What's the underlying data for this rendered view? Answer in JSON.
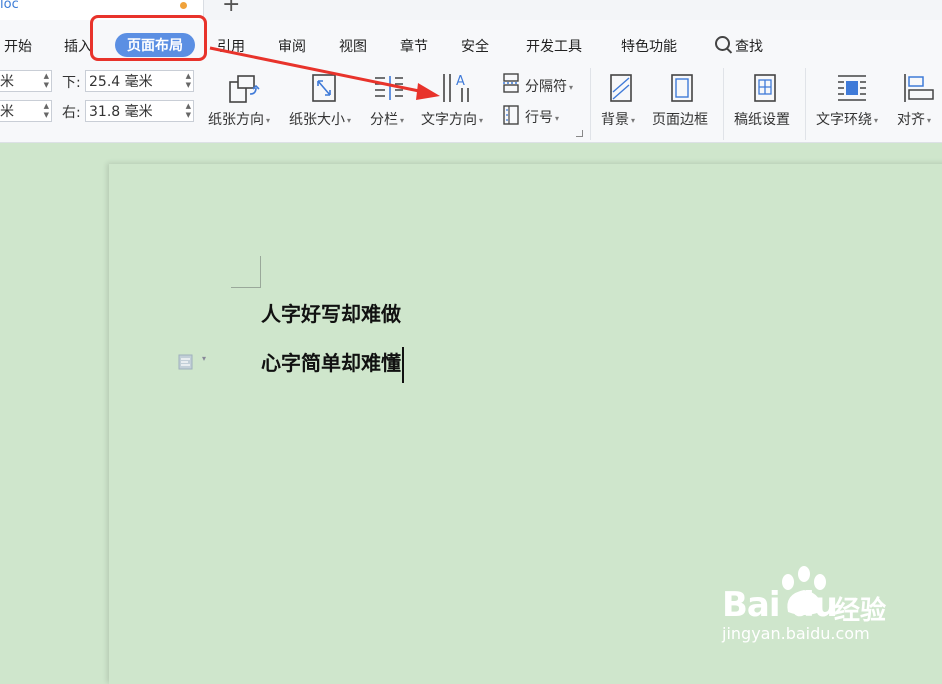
{
  "document_tab": {
    "name": "loc"
  },
  "menu": {
    "items": [
      "开始",
      "插入",
      "页面布局",
      "引用",
      "审阅",
      "视图",
      "章节",
      "安全",
      "开发工具",
      "特色功能"
    ],
    "active": "页面布局",
    "search_label": "查找"
  },
  "margins": {
    "top_left_value": "米",
    "bottom_left_value": "米",
    "bottom_label": "下:",
    "bottom_value": "25.4 毫米",
    "right_label": "右:",
    "right_value": "31.8 毫米"
  },
  "tools": {
    "orientation": "纸张方向",
    "size": "纸张大小",
    "columns": "分栏",
    "text_direction": "文字方向",
    "breaks": "分隔符",
    "line_numbers": "行号",
    "background": "背景",
    "page_border": "页面边框",
    "manuscript": "稿纸设置",
    "text_wrap": "文字环绕",
    "align": "对齐"
  },
  "document": {
    "line1": "人字好写却难做",
    "line2": "心字简单却难懂"
  },
  "watermark": {
    "brand": "Bai du",
    "brand_cn": "经验",
    "url": "jingyan.baidu.com"
  },
  "colors": {
    "ribbon_bg": "#f7f8fa",
    "active_tab": "#5b8fe3",
    "annotation_red": "#e8332b",
    "page_bg": "#cfe6cc"
  },
  "icons": [
    "search-icon",
    "orientation-icon",
    "paper-size-icon",
    "columns-icon",
    "text-direction-icon",
    "breaks-icon",
    "line-numbers-icon",
    "background-icon",
    "page-border-icon",
    "manuscript-icon",
    "text-wrap-icon",
    "align-icon",
    "paragraph-icon"
  ]
}
